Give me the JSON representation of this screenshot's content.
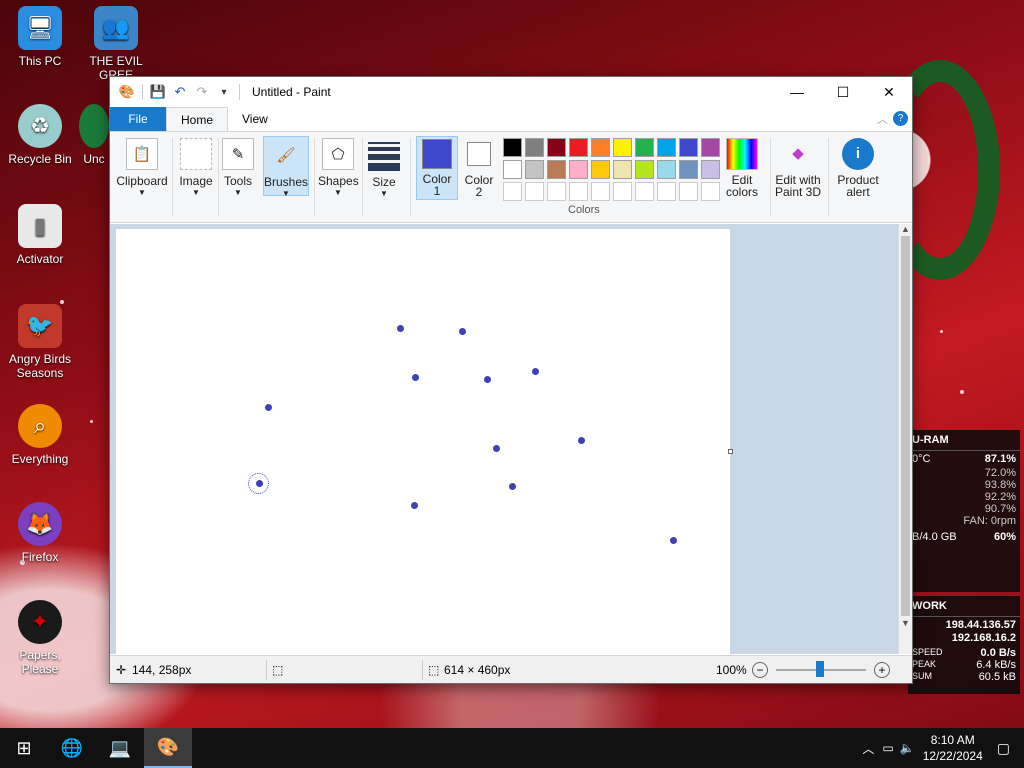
{
  "desktop": {
    "icons": [
      {
        "label": "This PC",
        "icon": "monitor-icon"
      },
      {
        "label": "THE EVIL GREE",
        "icon": "people-icon"
      },
      {
        "label": "Recycle Bin",
        "icon": "recycle-icon"
      },
      {
        "label": "Unc",
        "icon": "app-icon"
      },
      {
        "label": "Activator",
        "icon": "folder-icon"
      },
      {
        "label": "Angry Birds Seasons",
        "icon": "game-icon"
      },
      {
        "label": "Everything",
        "icon": "search-icon"
      },
      {
        "label": "Firefox",
        "icon": "firefox-icon"
      },
      {
        "label": "Papers, Please",
        "icon": "papers-icon"
      }
    ]
  },
  "paint": {
    "title": "Untitled - Paint",
    "tabs": {
      "file": "File",
      "home": "Home",
      "view": "View"
    },
    "ribbon": {
      "clipboard": "Clipboard",
      "image": "Image",
      "tools": "Tools",
      "brushes": "Brushes",
      "shapes": "Shapes",
      "size": "Size",
      "color1": "Color\n1",
      "color1_a": "Color",
      "color1_b": "1",
      "color2_a": "Color",
      "color2_b": "2",
      "colors": "Colors",
      "edit_colors_a": "Edit",
      "edit_colors_b": "colors",
      "paint3d_a": "Edit with",
      "paint3d_b": "Paint 3D",
      "alert_a": "Product",
      "alert_b": "alert"
    },
    "palette_row1": [
      "#000000",
      "#7f7f7f",
      "#880015",
      "#ed1c24",
      "#ff7f27",
      "#fff200",
      "#22b14c",
      "#00a2e8",
      "#3f48cc",
      "#a349a4"
    ],
    "palette_row2": [
      "#ffffff",
      "#c3c3c3",
      "#b97a57",
      "#ffaec9",
      "#ffc90e",
      "#efe4b0",
      "#b5e61d",
      "#99d9ea",
      "#7092be",
      "#c8bfe7"
    ],
    "accent": "#3f48cc",
    "status": {
      "cursor": "144, 258px",
      "canvas_size": "614 × 460px",
      "zoom": "100%"
    }
  },
  "widgets": {
    "cpu": {
      "title": "U-RAM",
      "temp": "0°C",
      "total": "87.1%",
      "cores": [
        "72.0%",
        "93.8%",
        "92.2%",
        "90.7%"
      ],
      "fan": "FAN: 0rpm",
      "ram": "B/4.0 GB",
      "ram_pct": "60%"
    },
    "network": {
      "title": "WORK",
      "ip_ext": "198.44.136.57",
      "ip_int": "192.168.16.2",
      "speed_label": "SPEED",
      "speed": "0.0 B/s",
      "peak_label": "PEAK",
      "peak": "6.4 kB/s",
      "sum_label": "SUM",
      "sum": "60.5 kB"
    }
  },
  "taskbar": {
    "time": "8:10 AM",
    "date": "12/22/2024"
  }
}
